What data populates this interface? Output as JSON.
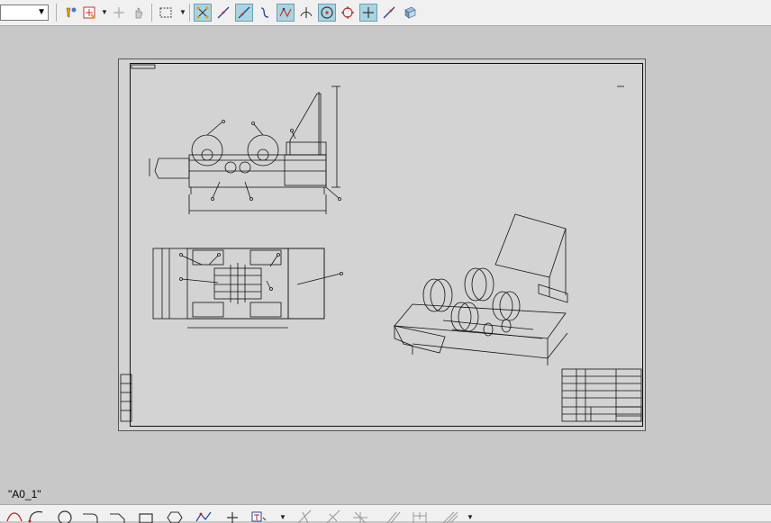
{
  "toolbar": {
    "combo_value": "",
    "icons": [
      "filter-icon",
      "snap-point-icon",
      "move-icon",
      "hand-icon",
      "select-box-icon",
      "snap-node-icon",
      "line-snap-icon",
      "perpendicular-icon",
      "curve-icon",
      "angle-icon",
      "intersection-icon",
      "center-icon",
      "tangent-icon",
      "crosshair-icon",
      "extend-line-icon",
      "view-3d-icon"
    ]
  },
  "canvas": {
    "sheet_name": "\"A0_1\""
  },
  "bottom_toolbar": {
    "icons": [
      "spline-icon",
      "arc-icon",
      "circle-icon",
      "fillet-icon",
      "chamfer-icon",
      "rectangle-icon",
      "polygon-icon",
      "polyline-icon",
      "point-icon",
      "text-icon",
      "trim-icon",
      "extend-icon",
      "offset-icon",
      "mirror-icon",
      "dimension-icon",
      "hatch-icon"
    ]
  },
  "colors": {
    "canvas_bg": "#c8c8c8",
    "sheet_bg": "#d3d3d3",
    "toolbar_bg": "#f0f0f0",
    "active_tool": "#a9d4e0"
  }
}
